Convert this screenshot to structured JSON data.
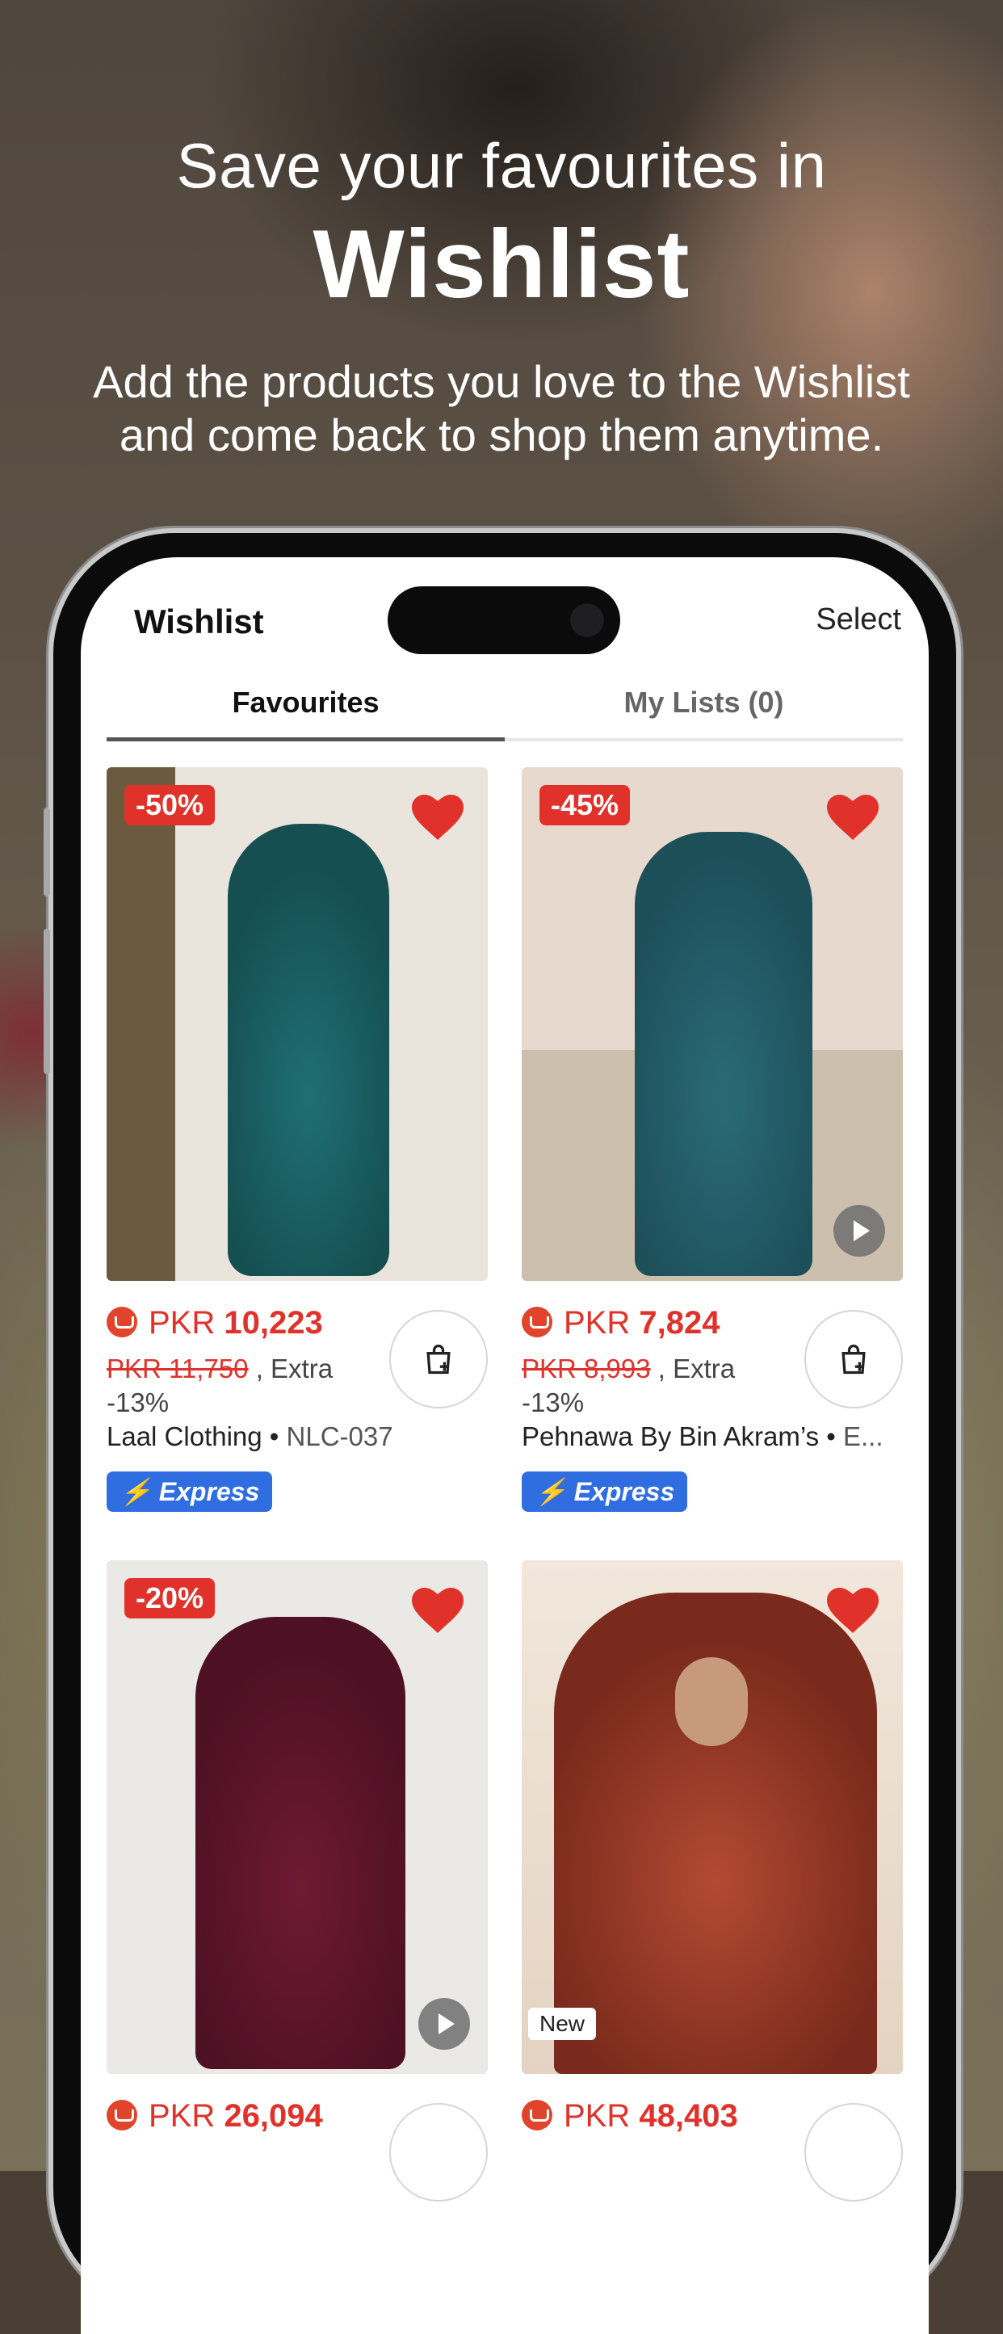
{
  "hero": {
    "line1": "Save your favourites in",
    "line2": "Wishlist",
    "sub_line1": "Add the products you love to the Wishlist",
    "sub_line2": "and come back to shop them anytime."
  },
  "app": {
    "title": "Wishlist",
    "select_label": "Select",
    "tabs": [
      {
        "label": "Favourites",
        "active": true
      },
      {
        "label": "My Lists (0)",
        "active": false
      }
    ]
  },
  "products": [
    {
      "badge": "-50%",
      "currency": "PKR",
      "price": "10,223",
      "old_price": "PKR 11,750",
      "extra": ", Extra -13%",
      "brand": "Laal Clothing",
      "code": "NLC-037",
      "express": "Express",
      "image_color": "#1f6f73"
    },
    {
      "badge": "-45%",
      "currency": "PKR",
      "price": "7,824",
      "old_price": "PKR 8,993",
      "extra": ", Extra -13%",
      "brand": "Pehnawa By Bin Akram’s",
      "code": "E...",
      "express": "Express",
      "image_color": "#2a6b78"
    },
    {
      "badge": "-20%",
      "currency": "PKR",
      "price": "26,094",
      "image_color": "#6e1a33"
    },
    {
      "badge": "",
      "new_label": "New",
      "currency": "PKR",
      "price": "48,403",
      "image_color": "#9c3a28"
    }
  ],
  "colors": {
    "accent": "#e0322a",
    "express": "#2f6de1"
  }
}
